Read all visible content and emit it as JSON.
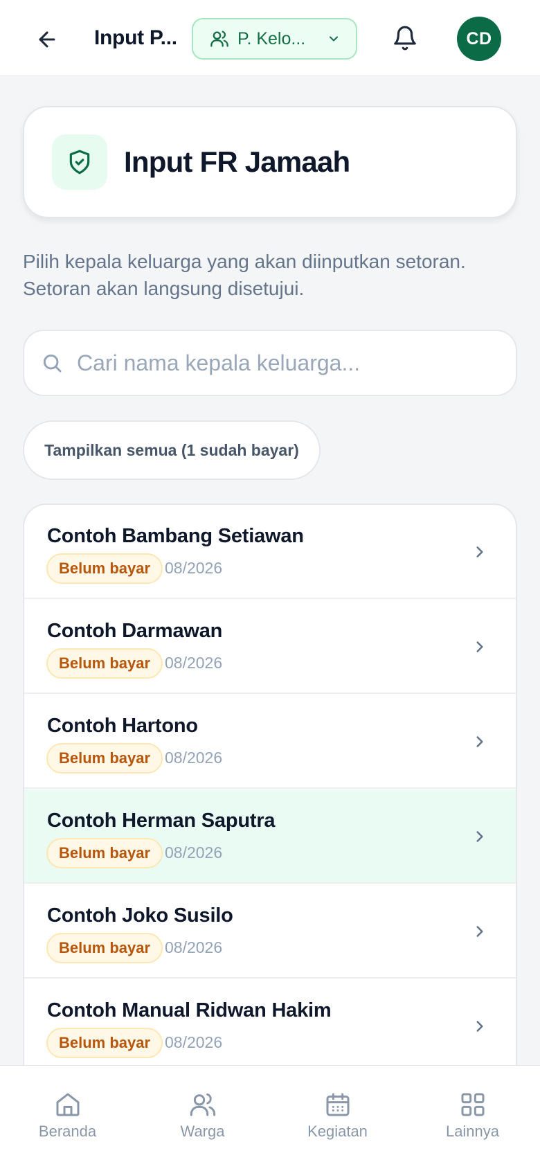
{
  "topbar": {
    "title": "Input P...",
    "group_selector": "P. Kelo...",
    "avatar_initials": "CD"
  },
  "header": {
    "title": "Input FR Jamaah"
  },
  "description": "Pilih kepala keluarga yang akan diinputkan setoran. Setoran akan langsung disetujui.",
  "search": {
    "placeholder": "Cari nama kepala keluarga...",
    "value": ""
  },
  "filter": {
    "show_all_label": "Tampilkan semua (1 sudah bayar)"
  },
  "list": {
    "items": [
      {
        "name": "Contoh Bambang Setiawan",
        "status": "Belum bayar",
        "period": "08/2026",
        "highlighted": false
      },
      {
        "name": "Contoh Darmawan",
        "status": "Belum bayar",
        "period": "08/2026",
        "highlighted": false
      },
      {
        "name": "Contoh Hartono",
        "status": "Belum bayar",
        "period": "08/2026",
        "highlighted": false
      },
      {
        "name": "Contoh Herman Saputra",
        "status": "Belum bayar",
        "period": "08/2026",
        "highlighted": true
      },
      {
        "name": "Contoh Joko Susilo",
        "status": "Belum bayar",
        "period": "08/2026",
        "highlighted": false
      },
      {
        "name": "Contoh Manual Ridwan Hakim",
        "status": "Belum bayar",
        "period": "08/2026",
        "highlighted": false
      }
    ]
  },
  "bottom_nav": {
    "items": [
      {
        "label": "Beranda",
        "icon": "home-icon"
      },
      {
        "label": "Warga",
        "icon": "users-icon"
      },
      {
        "label": "Kegiatan",
        "icon": "calendar-icon"
      },
      {
        "label": "Lainnya",
        "icon": "grid-icon"
      }
    ]
  },
  "colors": {
    "primary": "#0c6b47",
    "accent_bg": "#ecfdf3",
    "badge_text": "#b8570b",
    "badge_bg": "#fff8e6",
    "highlight_row": "#e9fbf2"
  }
}
